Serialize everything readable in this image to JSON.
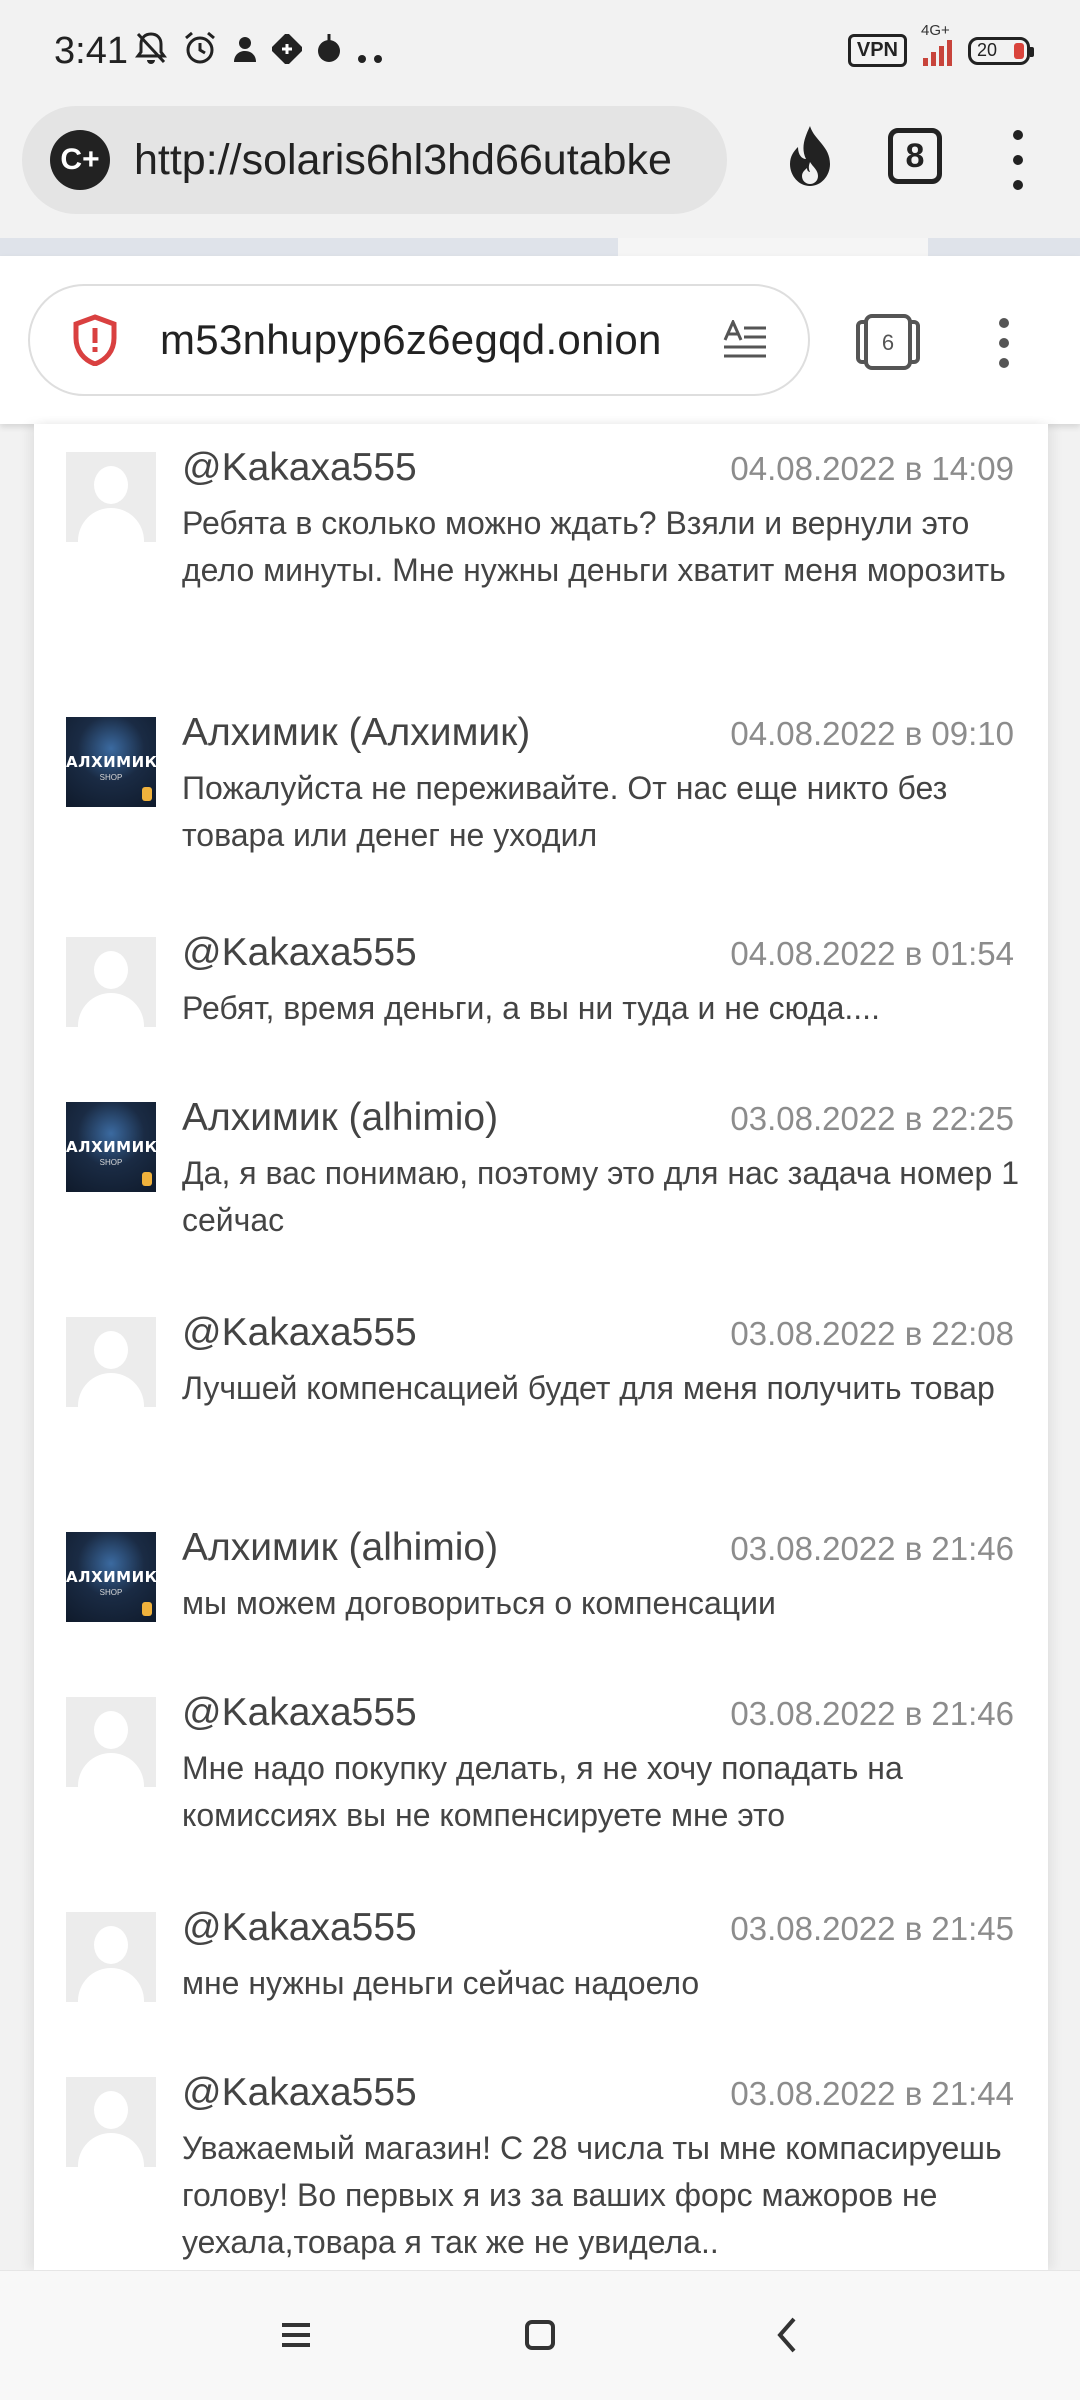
{
  "status_bar": {
    "time": "3:41",
    "vpn": "VPN",
    "network": "4G+",
    "battery": "20",
    "icons": [
      "bell-off-icon",
      "alarm-icon",
      "person-icon",
      "app-icon",
      "drop-icon",
      "more-icon"
    ]
  },
  "outer_browser": {
    "url": "http://solaris6hl3hd66utabke",
    "tab_count": "8",
    "icons": [
      "cplus-icon",
      "fire-icon",
      "tab-count-icon",
      "menu-icon"
    ]
  },
  "inner_browser": {
    "url": "m53nhupyp6z6egqd.onion",
    "tab_count": "6",
    "icons": [
      "shield-icon",
      "reader-mode-icon",
      "tabs-icon",
      "menu-icon"
    ]
  },
  "comments": [
    {
      "author": "@Kakaxa555",
      "date": "04.08.2022 в 14:09",
      "text": "Ребята в сколько можно ждать? Взяли и вернули это дело минуты. Мне нужны деньги хватит меня морозить",
      "avatar": "default"
    },
    {
      "author": "Алхимик (Алхимик)",
      "date": "04.08.2022 в 09:10",
      "text": "Пожалуйста не переживайте. От нас еще никто без товара или денег не уходил",
      "avatar": "shop"
    },
    {
      "author": "@Kakaxa555",
      "date": "04.08.2022 в 01:54",
      "text": "Ребят, время деньги, а вы ни туда и не сюда....",
      "avatar": "default"
    },
    {
      "author": "Алхимик (alhimio)",
      "date": "03.08.2022 в 22:25",
      "text": "Да, я вас понимаю, поэтому это для нас задача номер 1 сейчас",
      "avatar": "shop"
    },
    {
      "author": "@Kakaxa555",
      "date": "03.08.2022 в 22:08",
      "text": "Лучшей компенсацией будет для меня получить товар",
      "avatar": "default"
    },
    {
      "author": "Алхимик (alhimio)",
      "date": "03.08.2022 в 21:46",
      "text": "мы можем договориться о компенсации",
      "avatar": "shop"
    },
    {
      "author": "@Kakaxa555",
      "date": "03.08.2022 в 21:46",
      "text": "Мне надо покупку делать, я не хочу попадать на комиссиях вы не компенсируете мне это",
      "avatar": "default"
    },
    {
      "author": "@Kakaxa555",
      "date": "03.08.2022 в 21:45",
      "text": "мне нужны деньги сейчас надоело",
      "avatar": "default"
    },
    {
      "author": "@Kakaxa555",
      "date": "03.08.2022 в 21:44",
      "text": "Уважаемый магазин! С 28 числа ты мне компасируешь голову! Во первых я из за ваших форс мажоров не уехала,товара я так же не увидела..",
      "avatar": "default"
    }
  ],
  "shop_avatar": {
    "name": "АЛХИМИК",
    "sub": "SHOP"
  },
  "nav_bar": {
    "icons": [
      "recents-icon",
      "home-icon",
      "back-icon"
    ]
  }
}
